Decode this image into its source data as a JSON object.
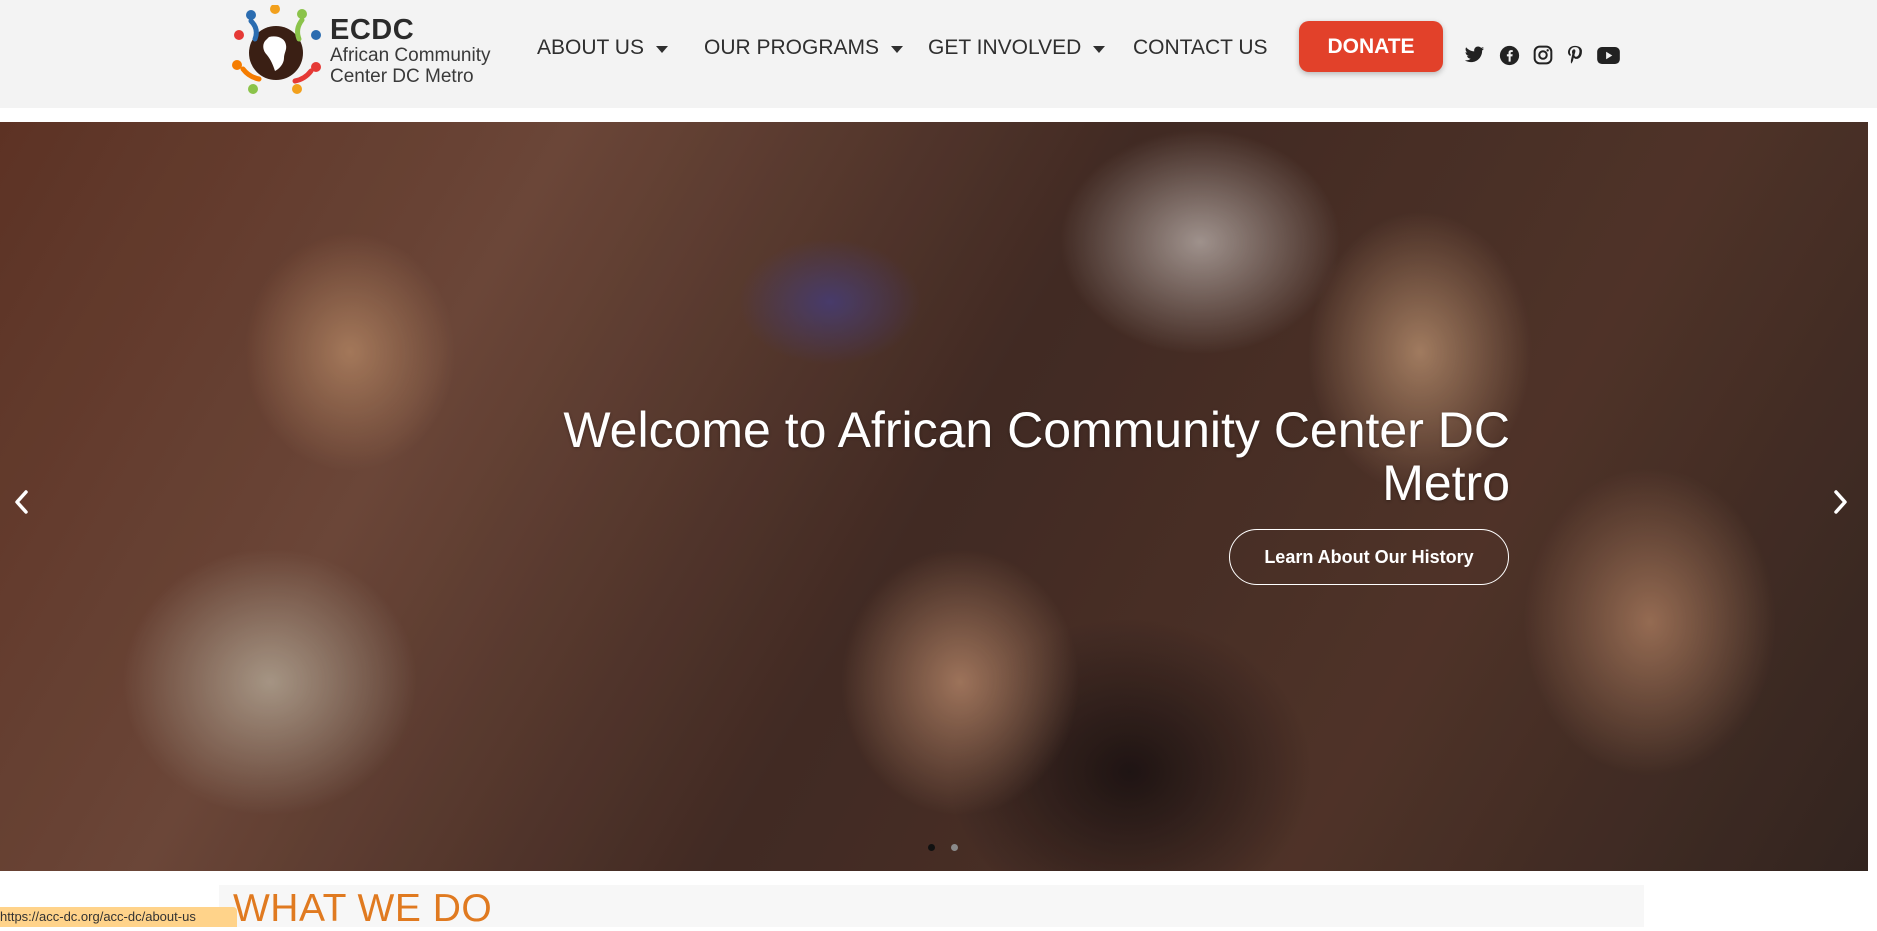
{
  "logo": {
    "brand": "ECDC",
    "line1": "African Community",
    "line2": "Center DC Metro"
  },
  "nav": {
    "items": [
      {
        "label": "ABOUT US"
      },
      {
        "label": "OUR PROGRAMS"
      },
      {
        "label": "GET INVOLVED"
      },
      {
        "label": "CONTACT US"
      }
    ],
    "donate_label": "DONATE"
  },
  "social": [
    "twitter-icon",
    "facebook-icon",
    "instagram-icon",
    "pinterest-icon",
    "youtube-icon"
  ],
  "hero": {
    "title": "Welcome to African Community Center DC Metro",
    "button_label": "Learn About Our History",
    "slide_count": 2,
    "active_slide": 1
  },
  "section": {
    "title": "WHAT WE DO"
  },
  "status_bar": {
    "url": "https://acc-dc.org/acc-dc/about-us"
  },
  "colors": {
    "donate": "#e2412a",
    "section_title": "#e07a20",
    "header_bg": "#f3f3f3"
  }
}
